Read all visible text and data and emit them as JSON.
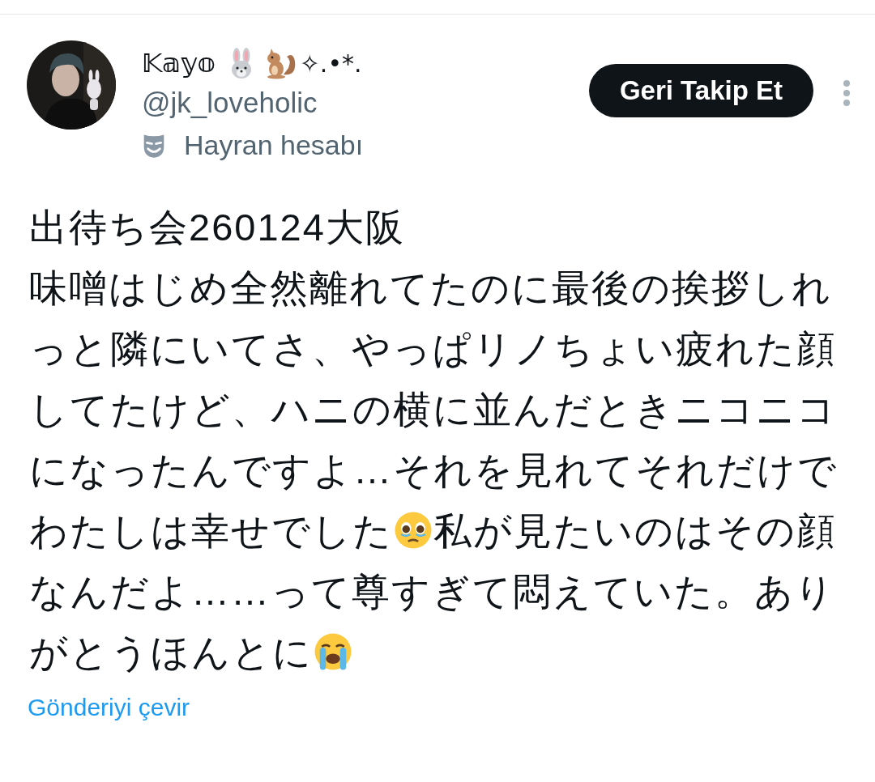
{
  "author": {
    "name": "𝕂𝕒𝕪𝕠",
    "name_suffix": "✧.•*.",
    "handle": "@jk_loveholic",
    "label": "Hayran hesabı"
  },
  "follow_button": {
    "label": "Geri Takip Et"
  },
  "post": {
    "lines": [
      [
        {
          "kind": "text",
          "text": "出待ち会260124大阪"
        }
      ],
      [
        {
          "kind": "text",
          "text": "味噌はじめ全然離れてたのに最後の挨拶しれっと隣にいてさ、やっぱリノちょい疲れた顔してたけど、ハニの横に並んだときニコニコになったんですよ…それを見れてそれだけでわたしは幸せでした"
        },
        {
          "kind": "pleading"
        },
        {
          "kind": "text",
          "text": "私が見たいのはその顔なんだよ……って尊すぎて悶えていた。ありがとうほんとに"
        },
        {
          "kind": "crying"
        }
      ]
    ]
  },
  "translate_link": "Gönderiyi çevir"
}
